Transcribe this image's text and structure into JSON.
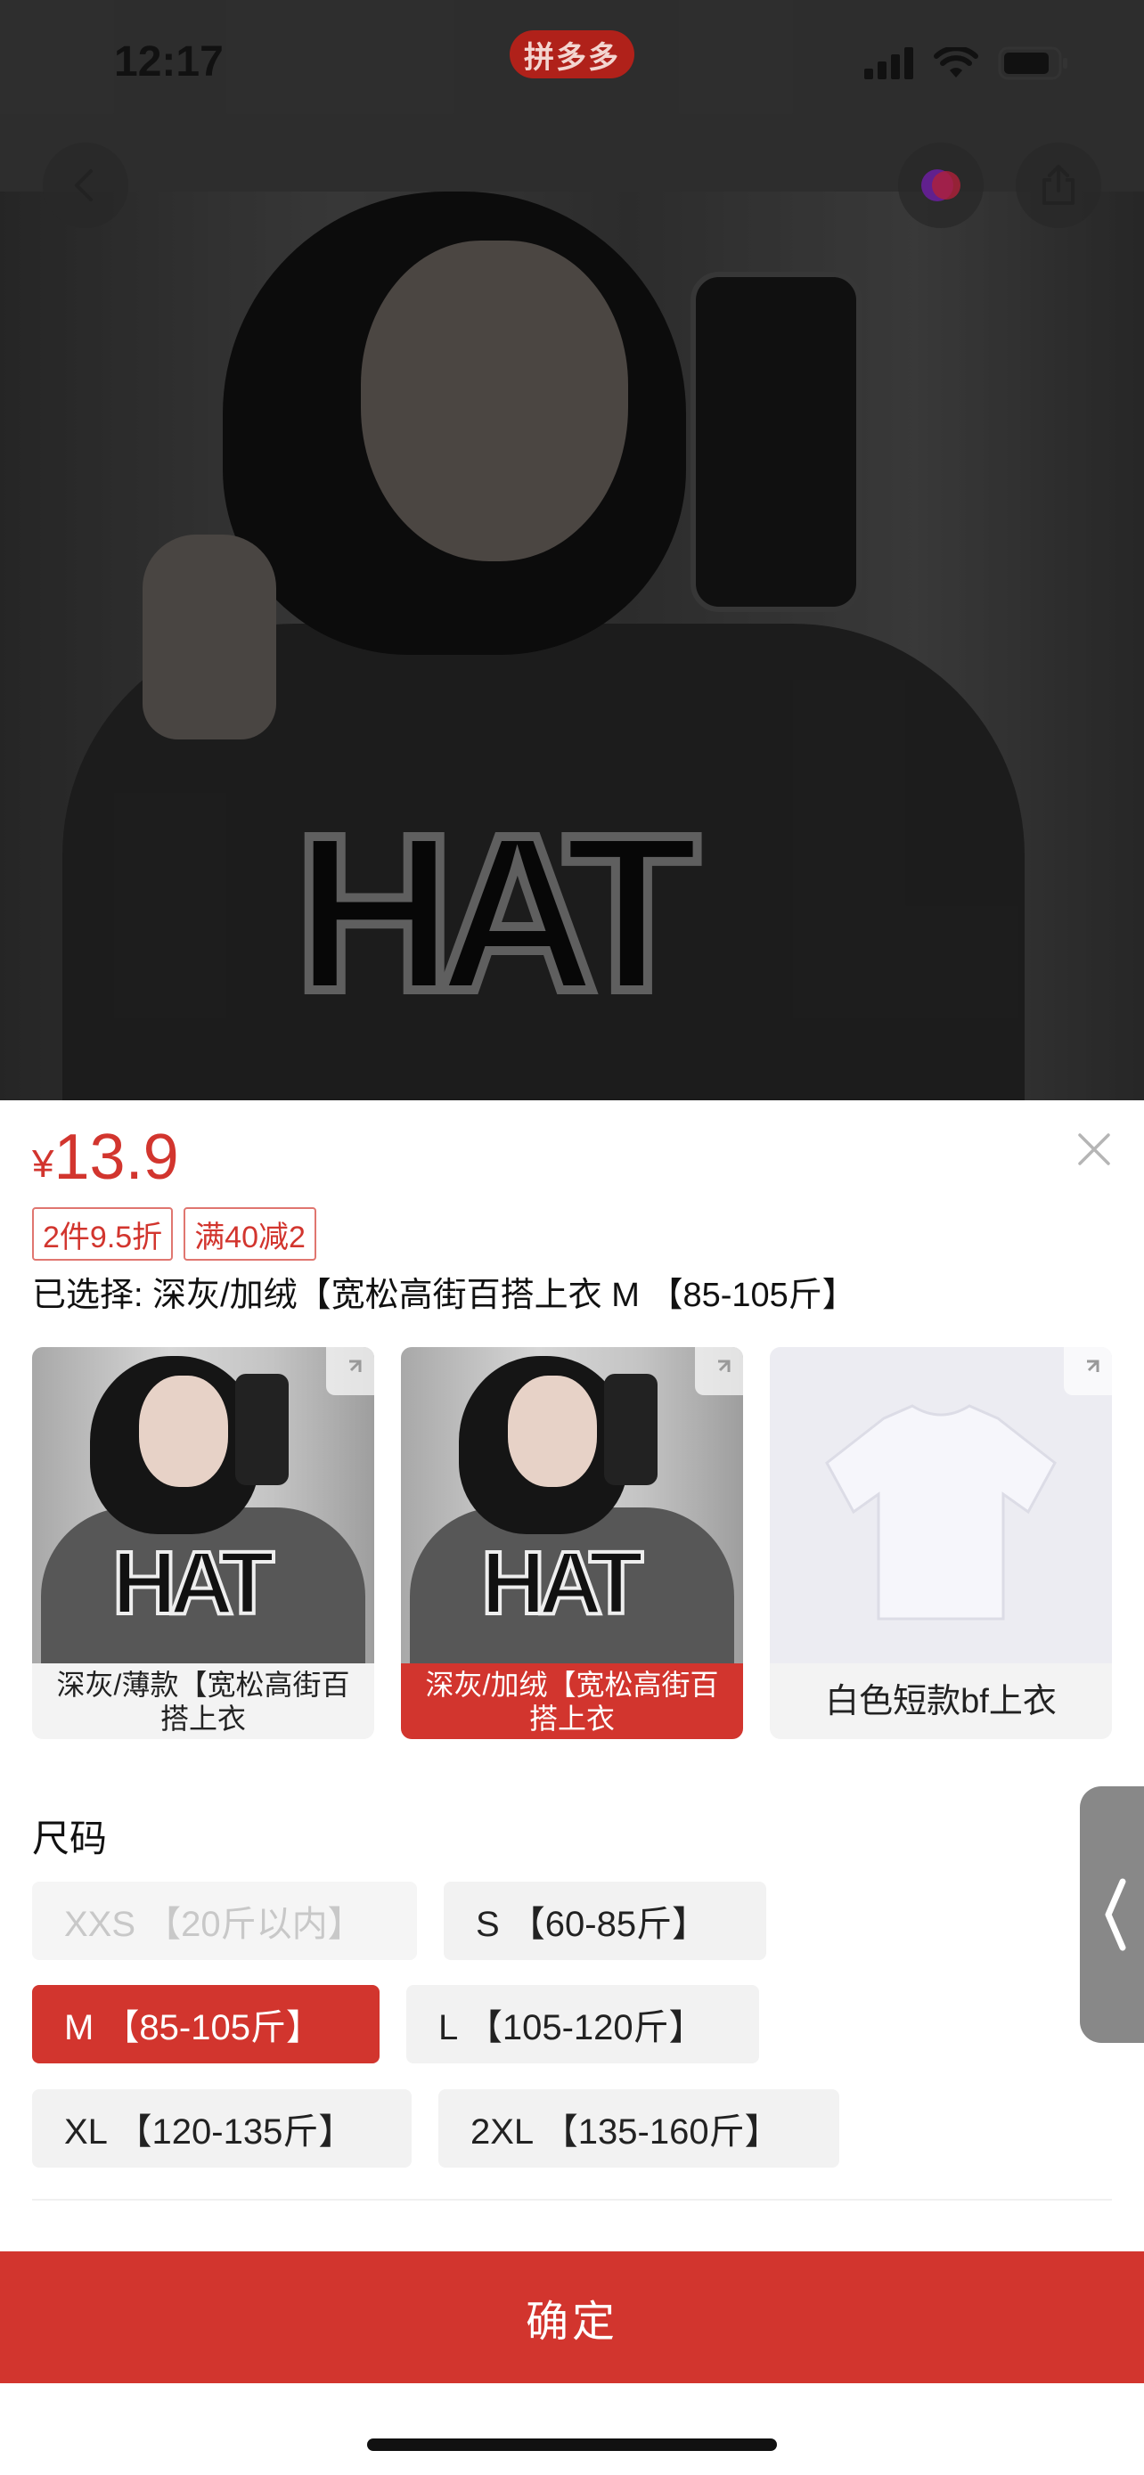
{
  "status_bar": {
    "time": "12:17",
    "center_badge": "拼多多"
  },
  "product": {
    "currency": "¥",
    "price": "13.9",
    "promo_tags": [
      "2件9.5折",
      "满40减2"
    ],
    "selected_label": "已选择: 深灰/加绒【宽松高街百搭上衣 M 【85-105斤】"
  },
  "variants": [
    {
      "label": "深灰/薄款【宽松高街百搭上衣",
      "selected": false
    },
    {
      "label": "深灰/加绒【宽松高街百搭上衣",
      "selected": true
    },
    {
      "label": "白色短款bf上衣",
      "selected": false
    }
  ],
  "size_section": {
    "title": "尺码",
    "options": [
      {
        "label": "XXS 【20斤以内】",
        "state": "disabled"
      },
      {
        "label": "S 【60-85斤】",
        "state": "normal"
      },
      {
        "label": "M 【85-105斤】",
        "state": "selected"
      },
      {
        "label": "L 【105-120斤】",
        "state": "normal"
      },
      {
        "label": "XL 【120-135斤】",
        "state": "normal"
      },
      {
        "label": "2XL 【135-160斤】",
        "state": "normal"
      }
    ]
  },
  "confirm_button": "确定",
  "colors": {
    "accent_red": "#d2352e",
    "chip_bg": "#f2f2f2"
  },
  "icons": [
    "back-arrow-icon",
    "favorite-icon",
    "share-icon",
    "close-icon",
    "expand-icon",
    "collapse-handle-icon",
    "signal-icon",
    "wifi-icon",
    "battery-icon"
  ]
}
